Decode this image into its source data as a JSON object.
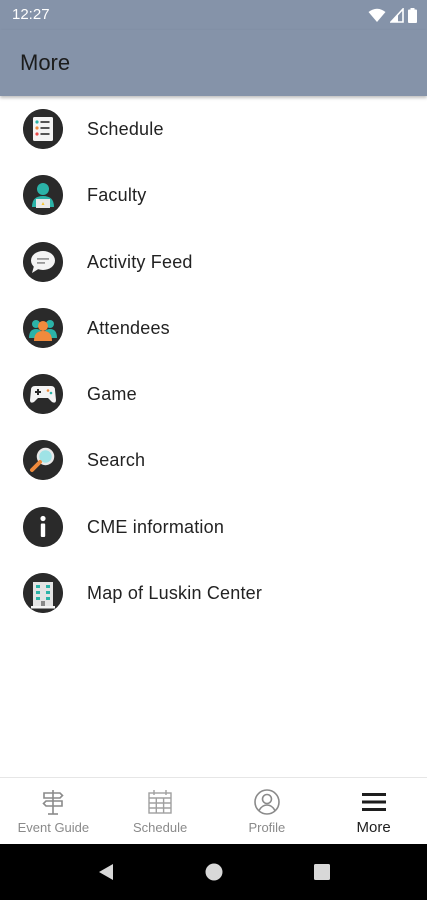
{
  "status_bar": {
    "time": "12:27",
    "icons": [
      "wifi-icon",
      "signal-icon",
      "battery-icon"
    ]
  },
  "app_bar": {
    "title": "More"
  },
  "menu": {
    "items": [
      {
        "label": "Schedule",
        "icon": "schedule-list-icon"
      },
      {
        "label": "Faculty",
        "icon": "faculty-person-icon"
      },
      {
        "label": "Activity Feed",
        "icon": "speech-bubble-icon"
      },
      {
        "label": "Attendees",
        "icon": "attendees-group-icon"
      },
      {
        "label": "Game",
        "icon": "gamepad-icon"
      },
      {
        "label": "Search",
        "icon": "magnifier-icon"
      },
      {
        "label": "CME information",
        "icon": "info-icon"
      },
      {
        "label": "Map of Luskin Center",
        "icon": "building-icon"
      }
    ]
  },
  "bottom_nav": {
    "tabs": [
      {
        "label": "Event Guide",
        "icon": "signpost-icon",
        "active": false
      },
      {
        "label": "Schedule",
        "icon": "calendar-icon",
        "active": false
      },
      {
        "label": "Profile",
        "icon": "profile-icon",
        "active": false
      },
      {
        "label": "More",
        "icon": "hamburger-menu-icon",
        "active": true
      }
    ]
  },
  "colors": {
    "app_bar": "#8593a9",
    "icon_circle": "#2a2a2a",
    "accent_teal": "#2bb3a8",
    "accent_orange": "#f08a3c",
    "inactive_tab": "#8a8a8a",
    "active_tab": "#1e1e1e"
  },
  "system_nav": {
    "buttons": [
      "back-icon",
      "home-icon",
      "recents-icon"
    ]
  }
}
